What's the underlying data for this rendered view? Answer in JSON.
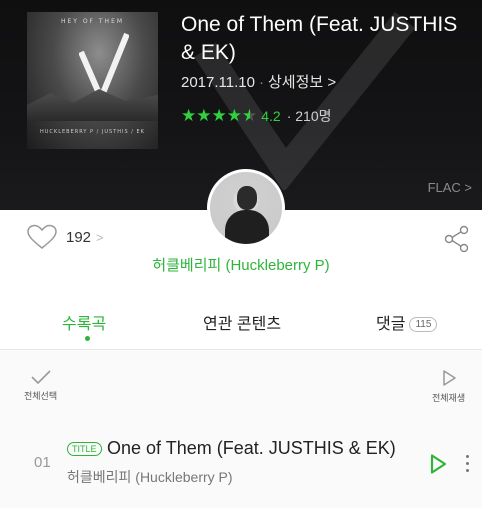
{
  "album": {
    "art_top_text": "HEY OF THEM",
    "art_bottom_text": "HUCKLEBERRY P / JUSTHIS / EK",
    "title": "One of Them (Feat. JUSTHIS & EK)",
    "date": "2017.11.10",
    "detail_link": "상세정보 >",
    "rating_score": "4.2",
    "rating_count": "210명",
    "rating_value": 4.5,
    "quality": "FLAC >"
  },
  "social": {
    "like_count": "192",
    "like_chevron": ">",
    "artist_name": "허클베리피 (Huckleberry P)"
  },
  "tabs": {
    "songs": "수록곡",
    "related": "연관 콘텐츠",
    "comments": "댓글",
    "comment_count": "115"
  },
  "actions": {
    "select_all": "전체선택",
    "play_all": "전체재생"
  },
  "track": {
    "number": "01",
    "badge": "TITLE",
    "title": "One of Them (Feat. JUSTHIS & EK)",
    "artist": "허클베리피 (Huckleberry P)"
  },
  "colors": {
    "accent": "#2db53a",
    "star": "#2fd13d",
    "header_bg": "#141416"
  },
  "icons": [
    "heart-icon",
    "share-icon",
    "checkmark-icon",
    "play-icon",
    "more-vertical-icon",
    "star-icon"
  ]
}
